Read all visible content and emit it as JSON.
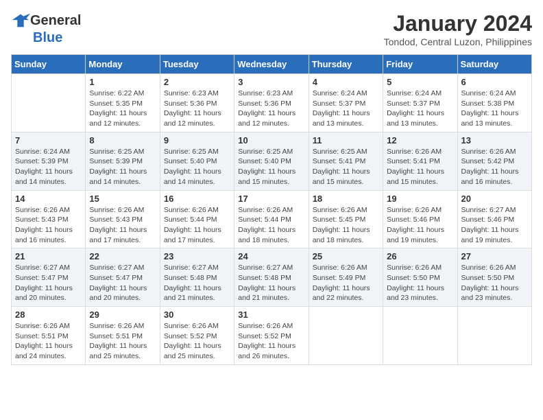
{
  "header": {
    "logo_general": "General",
    "logo_blue": "Blue",
    "title": "January 2024",
    "subtitle": "Tondod, Central Luzon, Philippines"
  },
  "days_of_week": [
    "Sunday",
    "Monday",
    "Tuesday",
    "Wednesday",
    "Thursday",
    "Friday",
    "Saturday"
  ],
  "weeks": [
    [
      {
        "day": "",
        "sunrise": "",
        "sunset": "",
        "daylight": ""
      },
      {
        "day": "1",
        "sunrise": "Sunrise: 6:22 AM",
        "sunset": "Sunset: 5:35 PM",
        "daylight": "Daylight: 11 hours and 12 minutes."
      },
      {
        "day": "2",
        "sunrise": "Sunrise: 6:23 AM",
        "sunset": "Sunset: 5:36 PM",
        "daylight": "Daylight: 11 hours and 12 minutes."
      },
      {
        "day": "3",
        "sunrise": "Sunrise: 6:23 AM",
        "sunset": "Sunset: 5:36 PM",
        "daylight": "Daylight: 11 hours and 12 minutes."
      },
      {
        "day": "4",
        "sunrise": "Sunrise: 6:24 AM",
        "sunset": "Sunset: 5:37 PM",
        "daylight": "Daylight: 11 hours and 13 minutes."
      },
      {
        "day": "5",
        "sunrise": "Sunrise: 6:24 AM",
        "sunset": "Sunset: 5:37 PM",
        "daylight": "Daylight: 11 hours and 13 minutes."
      },
      {
        "day": "6",
        "sunrise": "Sunrise: 6:24 AM",
        "sunset": "Sunset: 5:38 PM",
        "daylight": "Daylight: 11 hours and 13 minutes."
      }
    ],
    [
      {
        "day": "7",
        "sunrise": "Sunrise: 6:24 AM",
        "sunset": "Sunset: 5:39 PM",
        "daylight": "Daylight: 11 hours and 14 minutes."
      },
      {
        "day": "8",
        "sunrise": "Sunrise: 6:25 AM",
        "sunset": "Sunset: 5:39 PM",
        "daylight": "Daylight: 11 hours and 14 minutes."
      },
      {
        "day": "9",
        "sunrise": "Sunrise: 6:25 AM",
        "sunset": "Sunset: 5:40 PM",
        "daylight": "Daylight: 11 hours and 14 minutes."
      },
      {
        "day": "10",
        "sunrise": "Sunrise: 6:25 AM",
        "sunset": "Sunset: 5:40 PM",
        "daylight": "Daylight: 11 hours and 15 minutes."
      },
      {
        "day": "11",
        "sunrise": "Sunrise: 6:25 AM",
        "sunset": "Sunset: 5:41 PM",
        "daylight": "Daylight: 11 hours and 15 minutes."
      },
      {
        "day": "12",
        "sunrise": "Sunrise: 6:26 AM",
        "sunset": "Sunset: 5:41 PM",
        "daylight": "Daylight: 11 hours and 15 minutes."
      },
      {
        "day": "13",
        "sunrise": "Sunrise: 6:26 AM",
        "sunset": "Sunset: 5:42 PM",
        "daylight": "Daylight: 11 hours and 16 minutes."
      }
    ],
    [
      {
        "day": "14",
        "sunrise": "Sunrise: 6:26 AM",
        "sunset": "Sunset: 5:43 PM",
        "daylight": "Daylight: 11 hours and 16 minutes."
      },
      {
        "day": "15",
        "sunrise": "Sunrise: 6:26 AM",
        "sunset": "Sunset: 5:43 PM",
        "daylight": "Daylight: 11 hours and 17 minutes."
      },
      {
        "day": "16",
        "sunrise": "Sunrise: 6:26 AM",
        "sunset": "Sunset: 5:44 PM",
        "daylight": "Daylight: 11 hours and 17 minutes."
      },
      {
        "day": "17",
        "sunrise": "Sunrise: 6:26 AM",
        "sunset": "Sunset: 5:44 PM",
        "daylight": "Daylight: 11 hours and 18 minutes."
      },
      {
        "day": "18",
        "sunrise": "Sunrise: 6:26 AM",
        "sunset": "Sunset: 5:45 PM",
        "daylight": "Daylight: 11 hours and 18 minutes."
      },
      {
        "day": "19",
        "sunrise": "Sunrise: 6:26 AM",
        "sunset": "Sunset: 5:46 PM",
        "daylight": "Daylight: 11 hours and 19 minutes."
      },
      {
        "day": "20",
        "sunrise": "Sunrise: 6:27 AM",
        "sunset": "Sunset: 5:46 PM",
        "daylight": "Daylight: 11 hours and 19 minutes."
      }
    ],
    [
      {
        "day": "21",
        "sunrise": "Sunrise: 6:27 AM",
        "sunset": "Sunset: 5:47 PM",
        "daylight": "Daylight: 11 hours and 20 minutes."
      },
      {
        "day": "22",
        "sunrise": "Sunrise: 6:27 AM",
        "sunset": "Sunset: 5:47 PM",
        "daylight": "Daylight: 11 hours and 20 minutes."
      },
      {
        "day": "23",
        "sunrise": "Sunrise: 6:27 AM",
        "sunset": "Sunset: 5:48 PM",
        "daylight": "Daylight: 11 hours and 21 minutes."
      },
      {
        "day": "24",
        "sunrise": "Sunrise: 6:27 AM",
        "sunset": "Sunset: 5:48 PM",
        "daylight": "Daylight: 11 hours and 21 minutes."
      },
      {
        "day": "25",
        "sunrise": "Sunrise: 6:26 AM",
        "sunset": "Sunset: 5:49 PM",
        "daylight": "Daylight: 11 hours and 22 minutes."
      },
      {
        "day": "26",
        "sunrise": "Sunrise: 6:26 AM",
        "sunset": "Sunset: 5:50 PM",
        "daylight": "Daylight: 11 hours and 23 minutes."
      },
      {
        "day": "27",
        "sunrise": "Sunrise: 6:26 AM",
        "sunset": "Sunset: 5:50 PM",
        "daylight": "Daylight: 11 hours and 23 minutes."
      }
    ],
    [
      {
        "day": "28",
        "sunrise": "Sunrise: 6:26 AM",
        "sunset": "Sunset: 5:51 PM",
        "daylight": "Daylight: 11 hours and 24 minutes."
      },
      {
        "day": "29",
        "sunrise": "Sunrise: 6:26 AM",
        "sunset": "Sunset: 5:51 PM",
        "daylight": "Daylight: 11 hours and 25 minutes."
      },
      {
        "day": "30",
        "sunrise": "Sunrise: 6:26 AM",
        "sunset": "Sunset: 5:52 PM",
        "daylight": "Daylight: 11 hours and 25 minutes."
      },
      {
        "day": "31",
        "sunrise": "Sunrise: 6:26 AM",
        "sunset": "Sunset: 5:52 PM",
        "daylight": "Daylight: 11 hours and 26 minutes."
      },
      {
        "day": "",
        "sunrise": "",
        "sunset": "",
        "daylight": ""
      },
      {
        "day": "",
        "sunrise": "",
        "sunset": "",
        "daylight": ""
      },
      {
        "day": "",
        "sunrise": "",
        "sunset": "",
        "daylight": ""
      }
    ]
  ]
}
